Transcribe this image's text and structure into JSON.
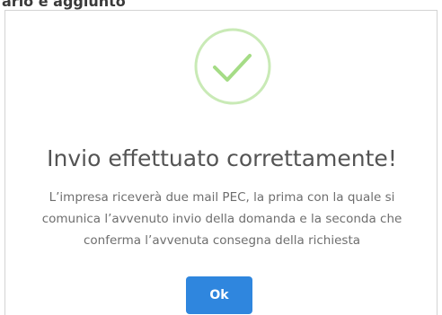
{
  "background": {
    "heading": "ario e aggiunto"
  },
  "dialog": {
    "icon": "check-circle-icon",
    "icon_color": "#a5dc86",
    "title": "Invio effettuato correttamente!",
    "message": "L’impresa riceverà due mail PEC, la prima con la quale si comunica l’avvenuto invio della domanda e la seconda che conferma l’avvenuta consegna della richiesta",
    "ok_label": "Ok",
    "button_color": "#2f86de"
  }
}
